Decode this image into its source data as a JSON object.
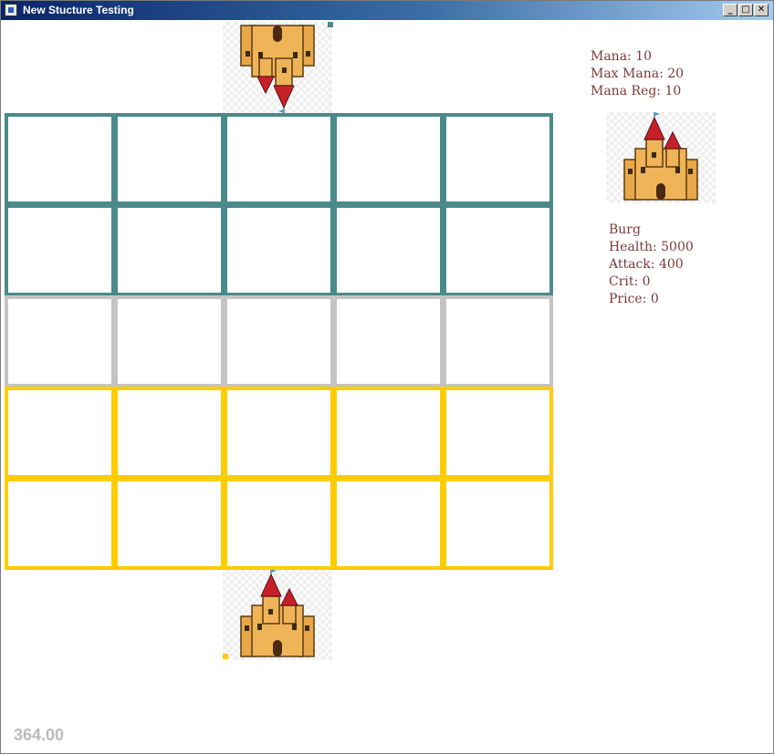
{
  "window": {
    "title": "New Stucture Testing",
    "controls": {
      "minimize": "_",
      "maximize": "□",
      "close": "✕"
    }
  },
  "board": {
    "rows": 5,
    "cols": 5,
    "row_colors": [
      "#4a8a8a",
      "#4a8a8a",
      "#c4c4c4",
      "#ffcc00",
      "#ffcc00"
    ]
  },
  "enemy_castle": {
    "icon": "castle-icon",
    "orientation": "upside-down",
    "marker_color": "#4a8a8a"
  },
  "player_castle": {
    "icon": "castle-icon",
    "orientation": "upright",
    "marker_color": "#ffcc00"
  },
  "player_stats": {
    "mana": "Mana: 10",
    "max_mana": "Max Mana: 20",
    "mana_reg": "Mana Reg: 10"
  },
  "selected_unit": {
    "icon": "castle-icon",
    "name": "Burg",
    "health": "Health: 5000",
    "attack": "Attack: 400",
    "crit": "Crit: 0",
    "price": "Price: 0"
  },
  "fps_counter": "364.00"
}
